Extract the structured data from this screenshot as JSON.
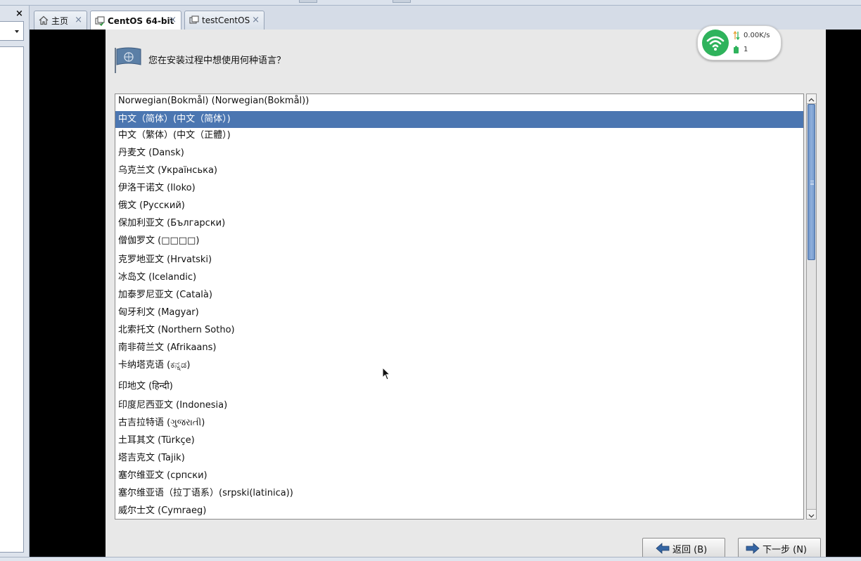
{
  "tabs": [
    {
      "label": "主页",
      "icon": "home-icon",
      "active": false
    },
    {
      "label": "CentOS 64-bit",
      "icon": "vm-icon",
      "active": true
    },
    {
      "label": "testCentOS",
      "icon": "vm-icon",
      "active": false
    }
  ],
  "close_glyph": "×",
  "left_panel": {
    "close_glyph": "×"
  },
  "installer": {
    "prompt": "您在安装过程中想使用何种语言？",
    "languages": [
      "Norwegian(Bokmål) (Norwegian(Bokmål))",
      "中文（简体）(中文（简体）)",
      "中文（繁体）(中文（正體）)",
      "丹麦文 (Dansk)",
      "乌克兰文 (Українська)",
      "伊洛干诺文 (Iloko)",
      "俄文 (Русский)",
      "保加利亚文 (Български)",
      "僧伽罗文 (□□□□)",
      "克罗地亚文 (Hrvatski)",
      "冰岛文 (Icelandic)",
      "加泰罗尼亚文 (Català)",
      "匈牙利文 (Magyar)",
      "北索托文 (Northern Sotho)",
      "南非荷兰文 (Afrikaans)",
      "卡纳塔克语 (ಕನ್ನಡ)",
      "印地文 (हिन्दी)",
      "印度尼西亚文 (Indonesia)",
      "古吉拉特语 (ગુજરાતી)",
      "土耳其文 (Türkçe)",
      "塔吉克文 (Tajik)",
      "塞尔维亚文 (српски)",
      "塞尔维亚语（拉丁语系）(srpski(latinica))",
      "威尔士文 (Cymraeg)"
    ],
    "selected_index": 1,
    "back_button": "返回 (B)",
    "next_button": "下一步 (N)"
  },
  "network": {
    "speed": "0.00K/s",
    "count": "1",
    "icon": "wifi-icon"
  },
  "colors": {
    "selection": "#4b76b1",
    "wifi": "#2fb35c"
  }
}
